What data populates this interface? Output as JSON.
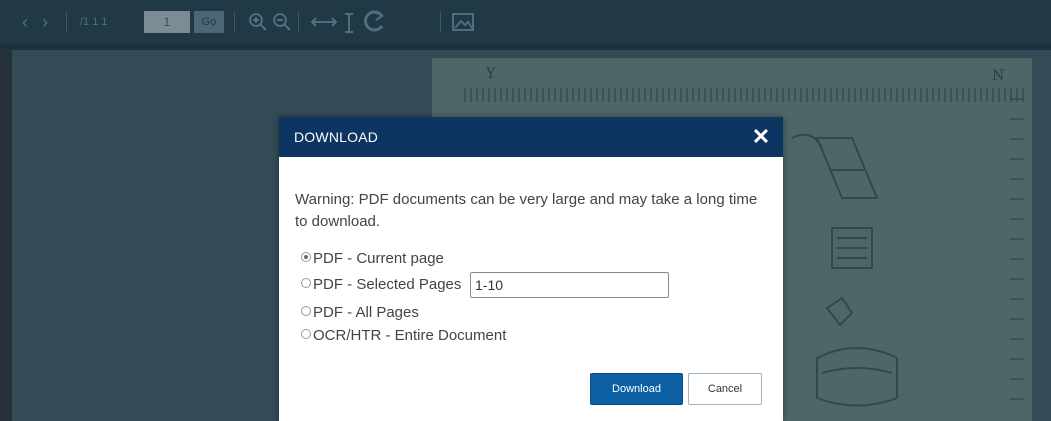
{
  "toolbar": {
    "prev_icon": "chevron-left-icon",
    "next_icon": "chevron-right-icon",
    "page_count": "/1 1 1",
    "page_value": "1",
    "go_label": "Go",
    "zoom_in_icon": "zoom-in-icon",
    "zoom_out_icon": "zoom-out-icon",
    "fit_width_icon": "fit-width-icon",
    "fit_height_icon": "fit-height-icon",
    "rotate_icon": "rotate-icon",
    "image_icon": "image-icon"
  },
  "document": {
    "note_left": "Y",
    "note_right": "N"
  },
  "modal": {
    "title": "DOWNLOAD",
    "close_glyph": "✕",
    "warning": "Warning: PDF documents can be very large and may take a long time to download.",
    "options": [
      {
        "label": "PDF - Current page",
        "selected": true
      },
      {
        "label": "PDF - Selected Pages",
        "selected": false
      },
      {
        "label": "PDF - All Pages",
        "selected": false
      },
      {
        "label": "OCR/HTR - Entire Document",
        "selected": false
      }
    ],
    "selected_pages_value": "1-10",
    "download_label": "Download",
    "cancel_label": "Cancel"
  },
  "colors": {
    "modal_header": "#0d3562",
    "primary_button": "#0d5fa3",
    "toolbar": "#213845"
  }
}
